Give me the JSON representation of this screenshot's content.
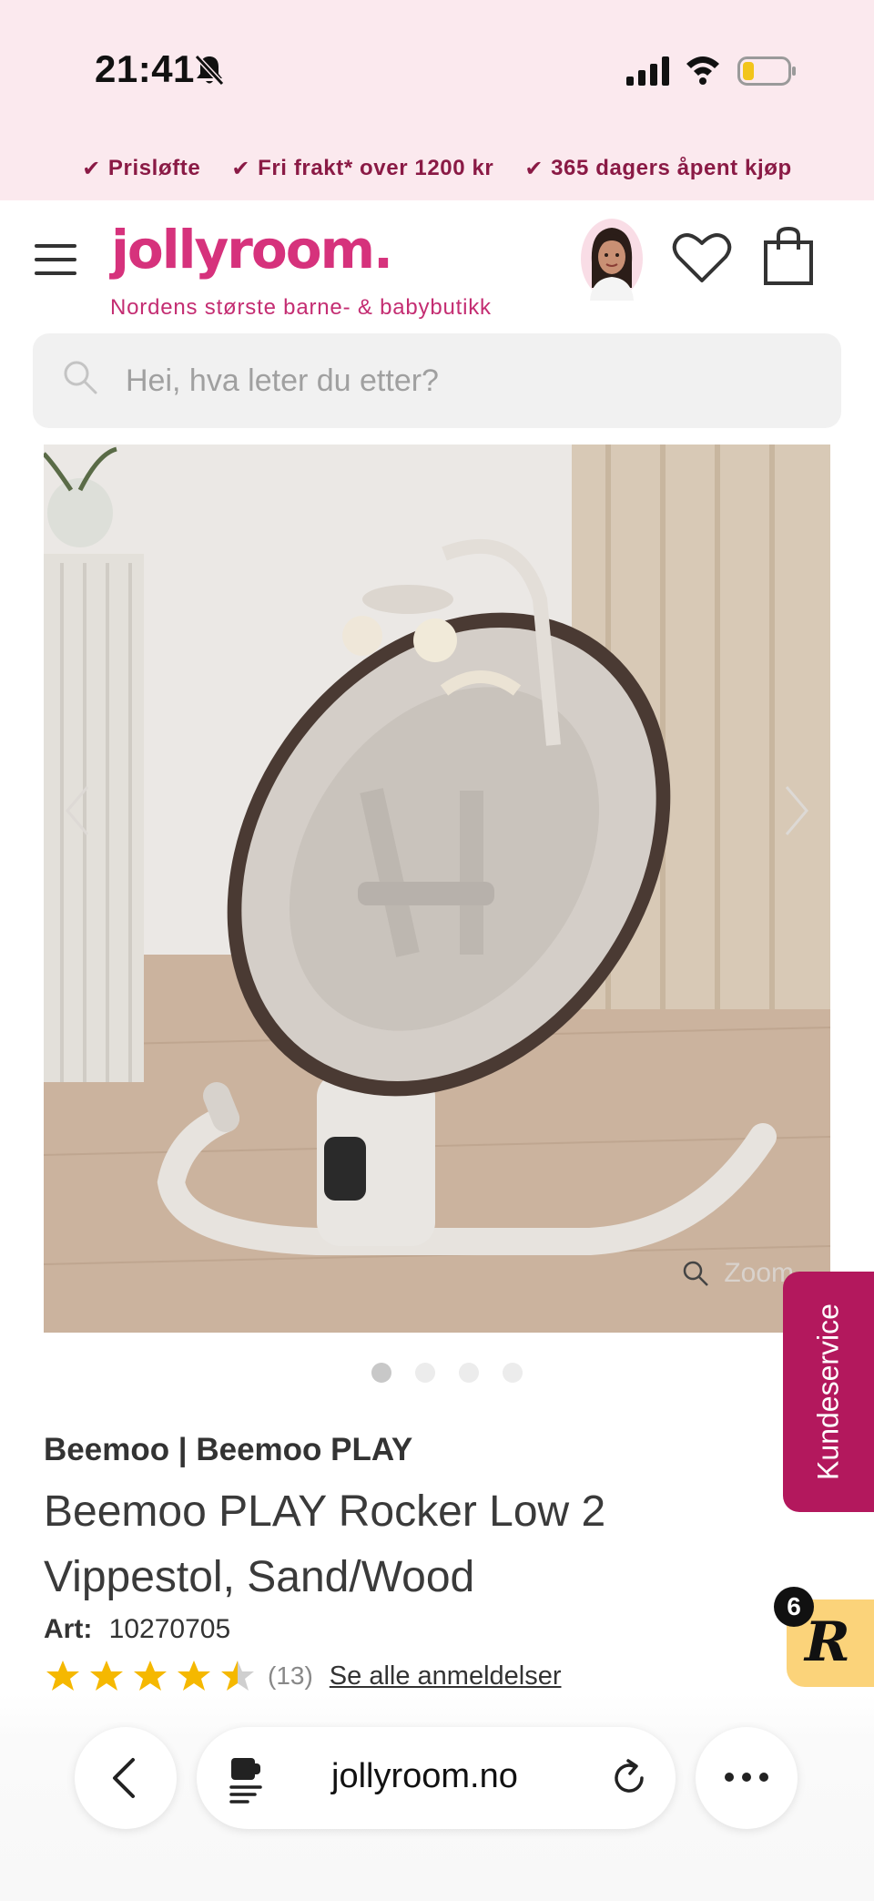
{
  "status_bar": {
    "time": "21:41",
    "icons": [
      "bell-off-icon",
      "cellular-signal-icon",
      "wifi-icon",
      "battery-low-icon"
    ]
  },
  "usp_bar": {
    "items": [
      {
        "icon": "check-icon",
        "label": "Prisløfte"
      },
      {
        "icon": "check-icon",
        "label": "Fri frakt* over 1200 kr"
      },
      {
        "icon": "check-icon",
        "label": "365 dagers åpent kjøp"
      }
    ]
  },
  "header": {
    "logo": "jollyroom.",
    "tagline": "Nordens største barne- & babybutikk",
    "icons": [
      "menu-icon",
      "avatar",
      "heart-icon",
      "bag-icon"
    ]
  },
  "search": {
    "placeholder": "Hei, hva leter du etter?"
  },
  "gallery": {
    "zoom_label": "Zoom",
    "image_count": 4,
    "active_index": 0
  },
  "product": {
    "brand": "Beemoo | Beemoo PLAY",
    "title": "Beemoo PLAY Rocker Low 2 Vippestol, Sand/Wood",
    "art_label": "Art:",
    "art_number": "10270705",
    "rating": 4.5,
    "rating_max": 5,
    "review_count": "(13)",
    "reviews_link": "Se alle anmeldelser"
  },
  "side_widgets": {
    "customer_service": "Kundeservice",
    "rewards_count": "6",
    "rewards_letter": "R"
  },
  "browser": {
    "url": "jollyroom.no"
  },
  "colors": {
    "brand_pink": "#d6327c",
    "usp_bg": "#fbe9ee",
    "usp_text": "#8a1a45",
    "service_tab": "#b3185d",
    "star": "#f5b800"
  }
}
